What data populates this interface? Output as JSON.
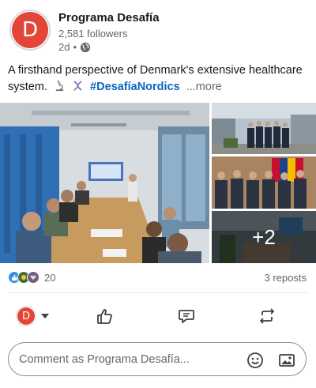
{
  "post": {
    "author": {
      "name": "Programa Desafía",
      "avatar_letter": "D",
      "followers": "2,581 followers",
      "time": "2d",
      "separator": "•"
    },
    "text": {
      "body": "A firsthand perspective of Denmark's extensive healthcare system.",
      "emojis": [
        "microscope",
        "dna"
      ],
      "hashtag": "#DesafíaNordics",
      "more": "...more"
    },
    "media": {
      "extra_count": "+2"
    },
    "stats": {
      "reaction_icons": [
        "like",
        "celebrate",
        "support"
      ],
      "reactions": "20",
      "reposts": "3 reposts"
    },
    "actions": [
      "like",
      "comment",
      "repost"
    ],
    "comment": {
      "placeholder": "Comment as Programa Desafía..."
    }
  },
  "colors": {
    "brand_red": "#e34539",
    "link_blue": "#0a66c2",
    "text_primary": "#191919",
    "text_secondary": "#666666"
  }
}
